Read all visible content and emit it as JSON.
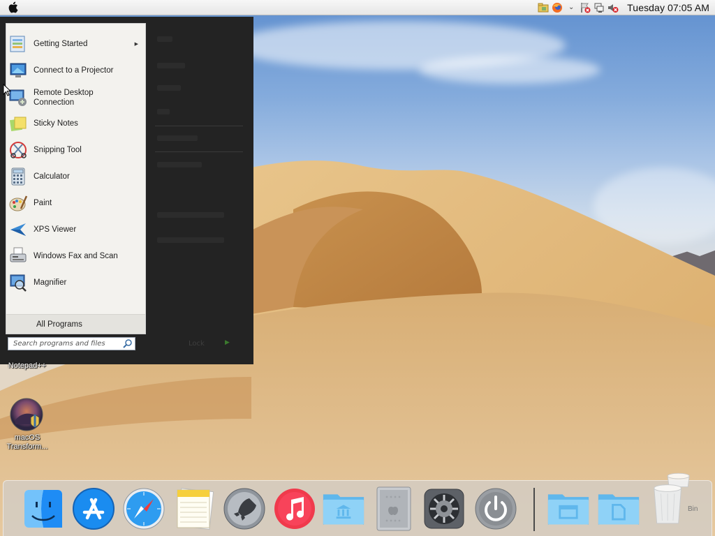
{
  "menubar": {
    "apple_icon": "apple-logo-icon",
    "clock": "Tuesday 07:05 AM",
    "tray_icons": [
      "network-folder-icon",
      "firefox-icon",
      "chevron-down-icon",
      "action-center-flag-icon",
      "network-icon",
      "volume-muted-icon"
    ]
  },
  "start_menu": {
    "programs": [
      {
        "label": "Getting Started",
        "icon": "getting-started-icon",
        "has_submenu": true
      },
      {
        "label": "Connect to a Projector",
        "icon": "projector-icon"
      },
      {
        "label": "Remote Desktop Connection",
        "icon": "remote-desktop-icon"
      },
      {
        "label": "Sticky Notes",
        "icon": "sticky-notes-icon"
      },
      {
        "label": "Snipping Tool",
        "icon": "snipping-tool-icon"
      },
      {
        "label": "Calculator",
        "icon": "calculator-icon"
      },
      {
        "label": "Paint",
        "icon": "paint-icon"
      },
      {
        "label": "XPS Viewer",
        "icon": "xps-viewer-icon"
      },
      {
        "label": "Windows Fax and Scan",
        "icon": "fax-scan-icon"
      },
      {
        "label": "Magnifier",
        "icon": "magnifier-icon"
      }
    ],
    "all_programs": "All Programs",
    "search_placeholder": "Search programs and files",
    "shutdown": "Lock"
  },
  "desktop": {
    "icons": [
      {
        "label": "Notepad++"
      },
      {
        "label": "macOS Transform..."
      }
    ]
  },
  "dock": {
    "items": [
      {
        "name": "finder-icon"
      },
      {
        "name": "app-store-icon"
      },
      {
        "name": "safari-icon"
      },
      {
        "name": "notes-icon"
      },
      {
        "name": "launchpad-icon"
      },
      {
        "name": "itunes-icon"
      },
      {
        "name": "applications-folder-icon"
      },
      {
        "name": "mac-pro-icon"
      },
      {
        "name": "system-preferences-icon"
      },
      {
        "name": "shutdown-icon"
      },
      {
        "name": "downloads-folder-icon"
      },
      {
        "name": "documents-folder-icon"
      },
      {
        "name": "trash-icon"
      }
    ],
    "trash_label": "Bin"
  },
  "colors": {
    "start_menu_bg": "#232323",
    "programs_bg": "#f3f2ee",
    "menubar_bg": "#ececec",
    "dock_bg": "#d2cdc6",
    "folder_blue": "#6ec3f0"
  }
}
